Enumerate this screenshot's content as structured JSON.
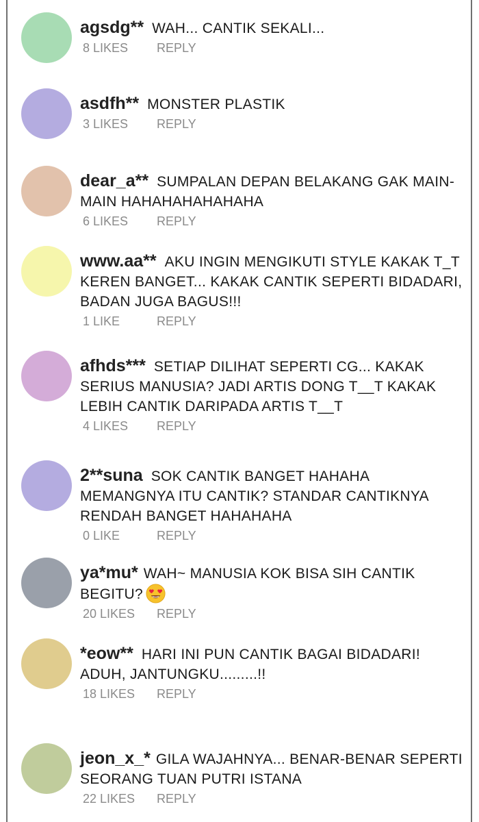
{
  "reply_label": "REPLY",
  "comments": [
    {
      "user": "agsdg**",
      "text": "WAH... CANTIK SEKALI...",
      "likes": "8 LIKES",
      "avatar_color": "#a8dcb4"
    },
    {
      "user": "asdfh**",
      "text": "MONSTER PLASTIK",
      "likes": "3 LIKES",
      "avatar_color": "#b4ace0"
    },
    {
      "user": "dear_a**",
      "text": "SUMPALAN DEPAN BELAKANG GAK MAIN-MAIN HAHAHAHAHAHAHA",
      "likes": "6 LIKES",
      "avatar_color": "#e2c2ac"
    },
    {
      "user": "www.aa**",
      "text": "AKU INGIN MENGIKUTI STYLE KAKAK T_T KEREN BANGET... KAKAK CANTIK SEPERTI BIDADARI, BADAN JUGA BAGUS!!!",
      "likes": "1 LIKE",
      "avatar_color": "#f6f6ac"
    },
    {
      "user": "afhds***",
      "text": "SETIAP DILIHAT SEPERTI CG... KAKAK SERIUS MANUSIA? JADI ARTIS DONG T__T KAKAK LEBIH CANTIK DARIPADA ARTIS T__T",
      "likes": "4 LIKES",
      "avatar_color": "#d4acd8"
    },
    {
      "user": "2**suna",
      "text": "SOK CANTIK BANGET HAHAHA MEMANGNYA ITU CANTIK? STANDAR CANTIKNYA RENDAH BANGET HAHAHAHA",
      "likes": "0 LIKE",
      "avatar_color": "#b4ace0"
    },
    {
      "user": "ya*mu*",
      "text": "WAH~ MANUSIA KOK BISA SIH CANTIK BEGITU?",
      "emoji": "heart-eyes-emoji",
      "likes": "20 LIKES",
      "avatar_color": "#9aa0aa"
    },
    {
      "user": "*eow**",
      "text": "HARI INI PUN CANTIK BAGAI BIDADARI! ADUH, JANTUNGKU.........!!",
      "likes": "18 LIKES",
      "avatar_color": "#e0cc8e"
    },
    {
      "user": "jeon_x_*",
      "text": "GILA WAJAHNYA... BENAR-BENAR SEPERTI SEORANG TUAN PUTRI ISTANA",
      "likes": "22 LIKES",
      "avatar_color": "#c0cc9c"
    }
  ]
}
